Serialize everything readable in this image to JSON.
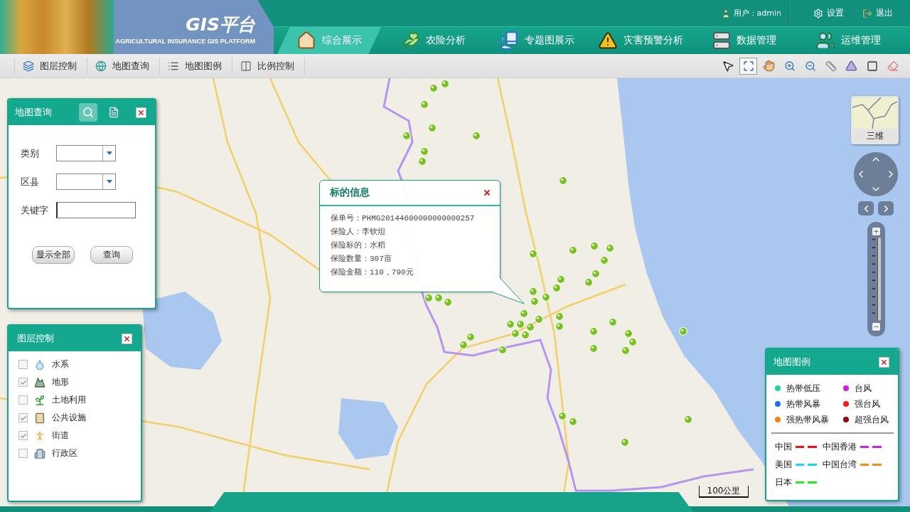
{
  "header": {
    "logo_title": "GIS平台",
    "logo_subtitle": "AGRICULTURAL INSURANCE GIS PLATFORM",
    "user": "用户：admin",
    "links": [
      {
        "kind": "settings",
        "label": "设置"
      },
      {
        "kind": "exit",
        "label": "退出"
      }
    ]
  },
  "nav": [
    {
      "kind": "home",
      "label": "综合展示",
      "selected": true
    },
    {
      "kind": "insurance",
      "label": "农险分析",
      "selected": false
    },
    {
      "kind": "thematic",
      "label": "专题图展示",
      "selected": false
    },
    {
      "kind": "warning",
      "label": "灾害预警分析",
      "selected": false
    },
    {
      "kind": "data",
      "label": "数据管理",
      "selected": false
    },
    {
      "kind": "ops",
      "label": "运维管理",
      "selected": false
    }
  ],
  "toolbar": {
    "items": [
      {
        "kind": "layers",
        "label": "图层控制"
      },
      {
        "kind": "query",
        "label": "地图查询"
      },
      {
        "kind": "legend",
        "label": "地图图例"
      },
      {
        "kind": "scale",
        "label": "比例控制"
      }
    ],
    "tools": [
      {
        "kind": "pointer",
        "selected": false
      },
      {
        "kind": "full_extent",
        "selected": true
      },
      {
        "kind": "pan",
        "selected": false
      },
      {
        "kind": "zoom_in",
        "selected": false
      },
      {
        "kind": "zoom_out",
        "selected": false
      },
      {
        "kind": "measure",
        "selected": false
      },
      {
        "kind": "polygon",
        "selected": false
      },
      {
        "kind": "rectangle",
        "selected": false
      },
      {
        "kind": "erase",
        "selected": false
      }
    ]
  },
  "query_panel": {
    "title": "地图查询",
    "tabs": [
      {
        "kind": "search",
        "selected": true
      },
      {
        "kind": "document",
        "selected": false
      }
    ],
    "fields": [
      {
        "kind": "select",
        "label": "类别"
      },
      {
        "kind": "select",
        "label": "区县"
      },
      {
        "kind": "text",
        "label": "关键字"
      }
    ],
    "buttons": [
      "显示全部",
      "查询"
    ]
  },
  "layer_panel": {
    "title": "图层控制",
    "layers": [
      {
        "kind": "water",
        "label": "水系",
        "checked": false
      },
      {
        "kind": "terrain",
        "label": "地形",
        "checked": true
      },
      {
        "kind": "land_use",
        "label": "土地利用",
        "checked": false
      },
      {
        "kind": "facilities",
        "label": "公共设施",
        "checked": true
      },
      {
        "kind": "streets",
        "label": "街道",
        "checked": true
      },
      {
        "kind": "admin",
        "label": "行政区",
        "checked": false
      }
    ]
  },
  "popup": {
    "title": "标的信息",
    "lines": [
      "保单号：PHMG20144600000000000257",
      "保险人：李钦炟",
      "保险标的：水稻",
      "保险数量：307亩",
      "保险金额：110，790元"
    ]
  },
  "map_controls": {
    "view_toggle": "三维",
    "zoom": {
      "level": 1
    },
    "scale": "100公里"
  },
  "legend": {
    "title": "地图图例",
    "categories": [
      {
        "label": "热带低压",
        "color": "#1fd39a"
      },
      {
        "label": "台风",
        "color": "#cc1fd6"
      },
      {
        "label": "热带风暴",
        "color": "#1f6ff0"
      },
      {
        "label": "强台风",
        "color": "#f02020"
      },
      {
        "label": "强热带风暴",
        "color": "#ff7f0e"
      },
      {
        "label": "超强台风",
        "color": "#8b0a0a"
      }
    ],
    "lines": [
      {
        "label": "中国",
        "color": "#ee1111"
      },
      {
        "label": "中国香港",
        "color": "#cc22ee"
      },
      {
        "label": "美国",
        "color": "#11ddee"
      },
      {
        "label": "中国台湾",
        "color": "#f09010"
      },
      {
        "label": "日本",
        "color": "#22ee22"
      }
    ]
  }
}
